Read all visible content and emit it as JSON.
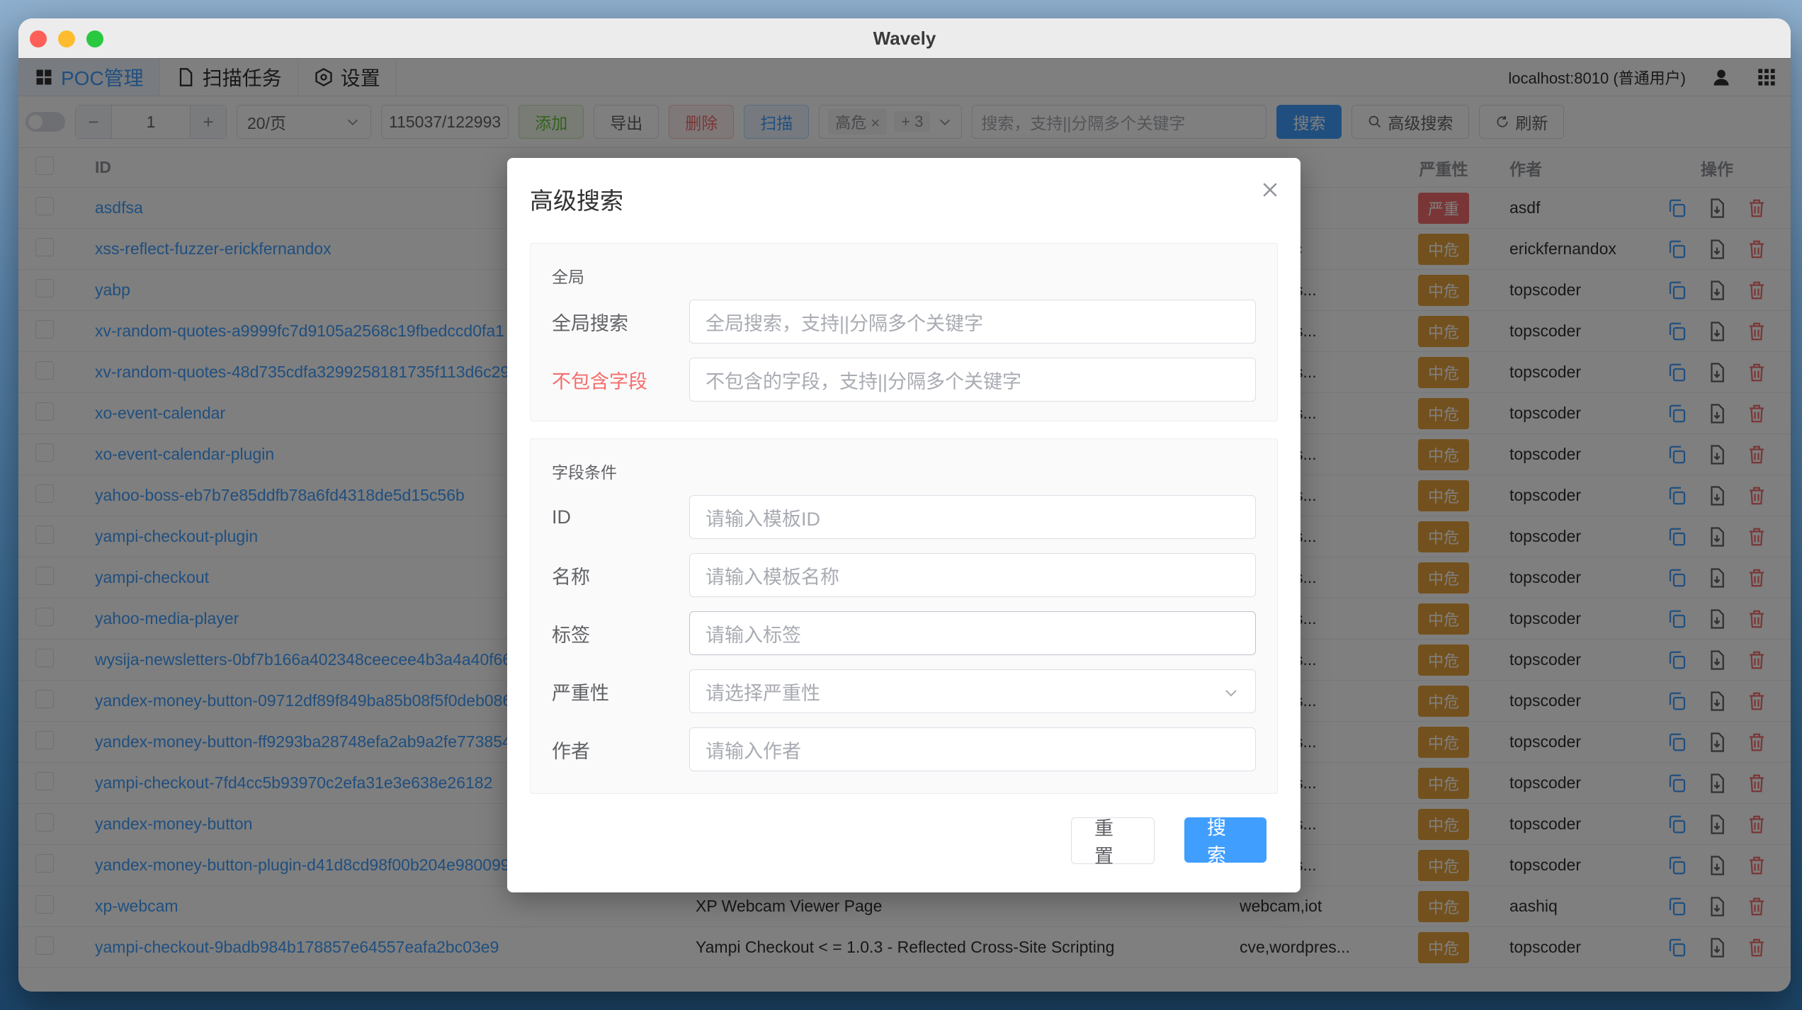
{
  "window": {
    "title": "Wavely"
  },
  "nav": {
    "items": [
      {
        "label": "POC管理",
        "icon": "grid-icon"
      },
      {
        "label": "扫描任务",
        "icon": "file-icon"
      },
      {
        "label": "设置",
        "icon": "gear-icon"
      }
    ],
    "server": "localhost:8010 (普通用户)"
  },
  "toolbar": {
    "page": "1",
    "page_size": "20/页",
    "count": "115037/122993",
    "add": "添加",
    "export": "导出",
    "delete": "删除",
    "scan": "扫描",
    "filter_tag": "高危",
    "filter_more": "+ 3",
    "search_placeholder": "搜索，支持||分隔多个关键字",
    "search": "搜索",
    "advanced": "高级搜索",
    "refresh": "刷新"
  },
  "table": {
    "headers": {
      "id": "ID",
      "severity": "严重性",
      "author": "作者",
      "actions": "操作"
    },
    "rows": [
      {
        "id": "asdfsa",
        "name": "",
        "tags": "",
        "severity": "严重",
        "author": "asdf"
      },
      {
        "id": "xss-reflect-fuzzer-erickfernandox",
        "name": "",
        "tags": "r,generic",
        "severity": "中危",
        "author": "erickfernandox"
      },
      {
        "id": "yabp",
        "name": "",
        "tags": "vordpres...",
        "severity": "中危",
        "author": "topscoder"
      },
      {
        "id": "xv-random-quotes-a9999fc7d9105a2568c19fbedccd0fa1",
        "name": "",
        "tags": "vordpres...",
        "severity": "中危",
        "author": "topscoder"
      },
      {
        "id": "xv-random-quotes-48d735cdfa3299258181735f113d6c29",
        "name": "",
        "tags": "vordpres...",
        "severity": "中危",
        "author": "topscoder"
      },
      {
        "id": "xo-event-calendar",
        "name": "",
        "tags": "vordpres...",
        "severity": "中危",
        "author": "topscoder"
      },
      {
        "id": "xo-event-calendar-plugin",
        "name": "",
        "tags": "vordpres...",
        "severity": "中危",
        "author": "topscoder"
      },
      {
        "id": "yahoo-boss-eb7b7e85ddfb78a6fd4318de5d15c56b",
        "name": "",
        "tags": "vordpres...",
        "severity": "中危",
        "author": "topscoder"
      },
      {
        "id": "yampi-checkout-plugin",
        "name": "",
        "tags": "vordpres...",
        "severity": "中危",
        "author": "topscoder"
      },
      {
        "id": "yampi-checkout",
        "name": "",
        "tags": "vordpres...",
        "severity": "中危",
        "author": "topscoder"
      },
      {
        "id": "yahoo-media-player",
        "name": "",
        "tags": "vordpres...",
        "severity": "中危",
        "author": "topscoder"
      },
      {
        "id": "wysija-newsletters-0bf7b166a402348ceecee4b3a4a40f66",
        "name": "",
        "tags": "vordpres...",
        "severity": "中危",
        "author": "topscoder"
      },
      {
        "id": "yandex-money-button-09712df89f849ba85b08f5f0deb0865",
        "name": "",
        "tags": "vordpres...",
        "severity": "中危",
        "author": "topscoder"
      },
      {
        "id": "yandex-money-button-ff9293ba28748efa2ab9a2fe77385468",
        "name": "",
        "tags": "vordpres...",
        "severity": "中危",
        "author": "topscoder"
      },
      {
        "id": "yampi-checkout-7fd4cc5b93970c2efa31e3e638e26182",
        "name": "",
        "tags": "vordpres...",
        "severity": "中危",
        "author": "topscoder"
      },
      {
        "id": "yandex-money-button",
        "name": "",
        "tags": "vordpres...",
        "severity": "中危",
        "author": "topscoder"
      },
      {
        "id": "yandex-money-button-plugin-d41d8cd98f00b204e9800998",
        "name": "",
        "tags": "vordpres...",
        "severity": "中危",
        "author": "topscoder"
      },
      {
        "id": "xp-webcam",
        "name": "XP Webcam Viewer Page",
        "tags": "webcam,iot",
        "severity": "中危",
        "author": "aashiq"
      },
      {
        "id": "yampi-checkout-9badb984b178857e64557eafa2bc03e9",
        "name": "Yampi Checkout < = 1.0.3 - Reflected Cross-Site Scripting",
        "tags": "cve,wordpres...",
        "severity": "中危",
        "author": "topscoder"
      }
    ]
  },
  "dialog": {
    "title": "高级搜索",
    "global_section": "全局",
    "global_search_label": "全局搜索",
    "global_search_placeholder": "全局搜索，支持||分隔多个关键字",
    "exclude_label": "不包含字段",
    "exclude_placeholder": "不包含的字段，支持||分隔多个关键字",
    "field_section": "字段条件",
    "id_label": "ID",
    "id_placeholder": "请输入模板ID",
    "name_label": "名称",
    "name_placeholder": "请输入模板名称",
    "tags_label": "标签",
    "tags_placeholder": "请输入标签",
    "severity_label": "严重性",
    "severity_placeholder": "请选择严重性",
    "author_label": "作者",
    "author_placeholder": "请输入作者",
    "reset": "重置",
    "search": "搜索"
  },
  "colors": {
    "primary": "#409eff",
    "critical": "#f56c6c",
    "high": "#e6a23c"
  }
}
